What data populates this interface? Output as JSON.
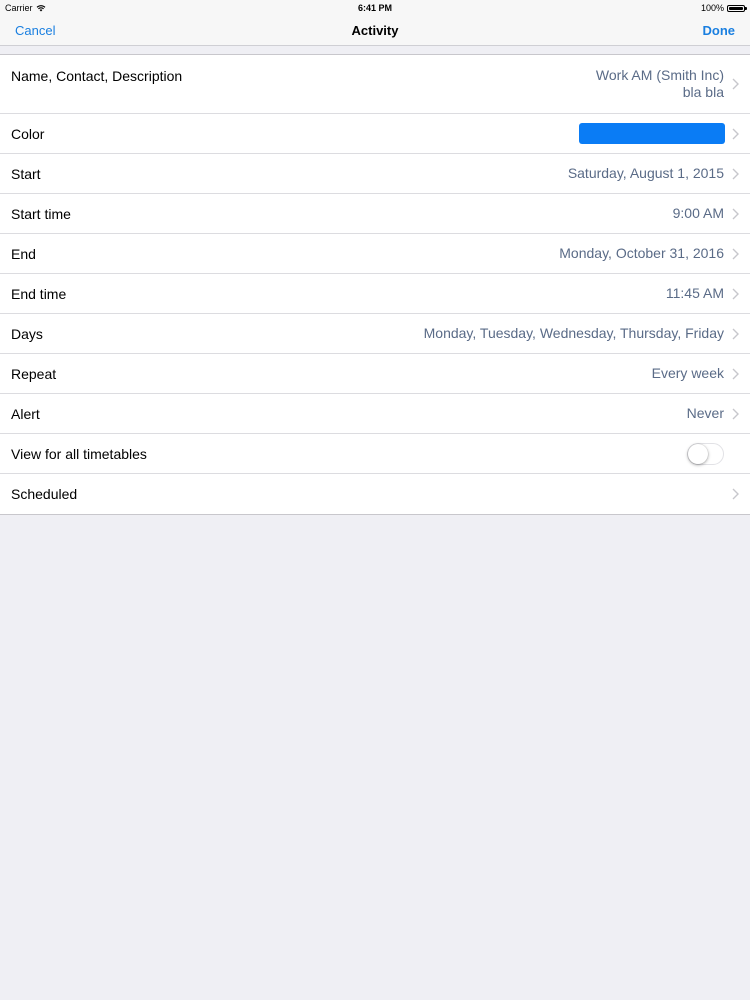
{
  "status_bar": {
    "carrier": "Carrier",
    "time": "6:41 PM",
    "battery": "100%"
  },
  "nav": {
    "cancel_label": "Cancel",
    "title": "Activity",
    "done_label": "Done"
  },
  "colors": {
    "accent": "#1a7fe0",
    "activity_color": "#0a7cf5",
    "value_text": "#5a6b87"
  },
  "rows": {
    "name": {
      "label": "Name, Contact, Description",
      "value_line1": "Work AM (Smith Inc)",
      "value_line2": "bla bla"
    },
    "color": {
      "label": "Color"
    },
    "start": {
      "label": "Start",
      "value": "Saturday, August 1, 2015"
    },
    "start_time": {
      "label": "Start time",
      "value": "9:00 AM"
    },
    "end": {
      "label": "End",
      "value": "Monday, October 31, 2016"
    },
    "end_time": {
      "label": "End time",
      "value": "11:45 AM"
    },
    "days": {
      "label": "Days",
      "value": "Monday, Tuesday, Wednesday, Thursday, Friday"
    },
    "repeat": {
      "label": "Repeat",
      "value": "Every week"
    },
    "alert": {
      "label": "Alert",
      "value": "Never"
    },
    "view_all": {
      "label": "View for all timetables",
      "toggle_on": false
    },
    "scheduled": {
      "label": "Scheduled"
    }
  }
}
